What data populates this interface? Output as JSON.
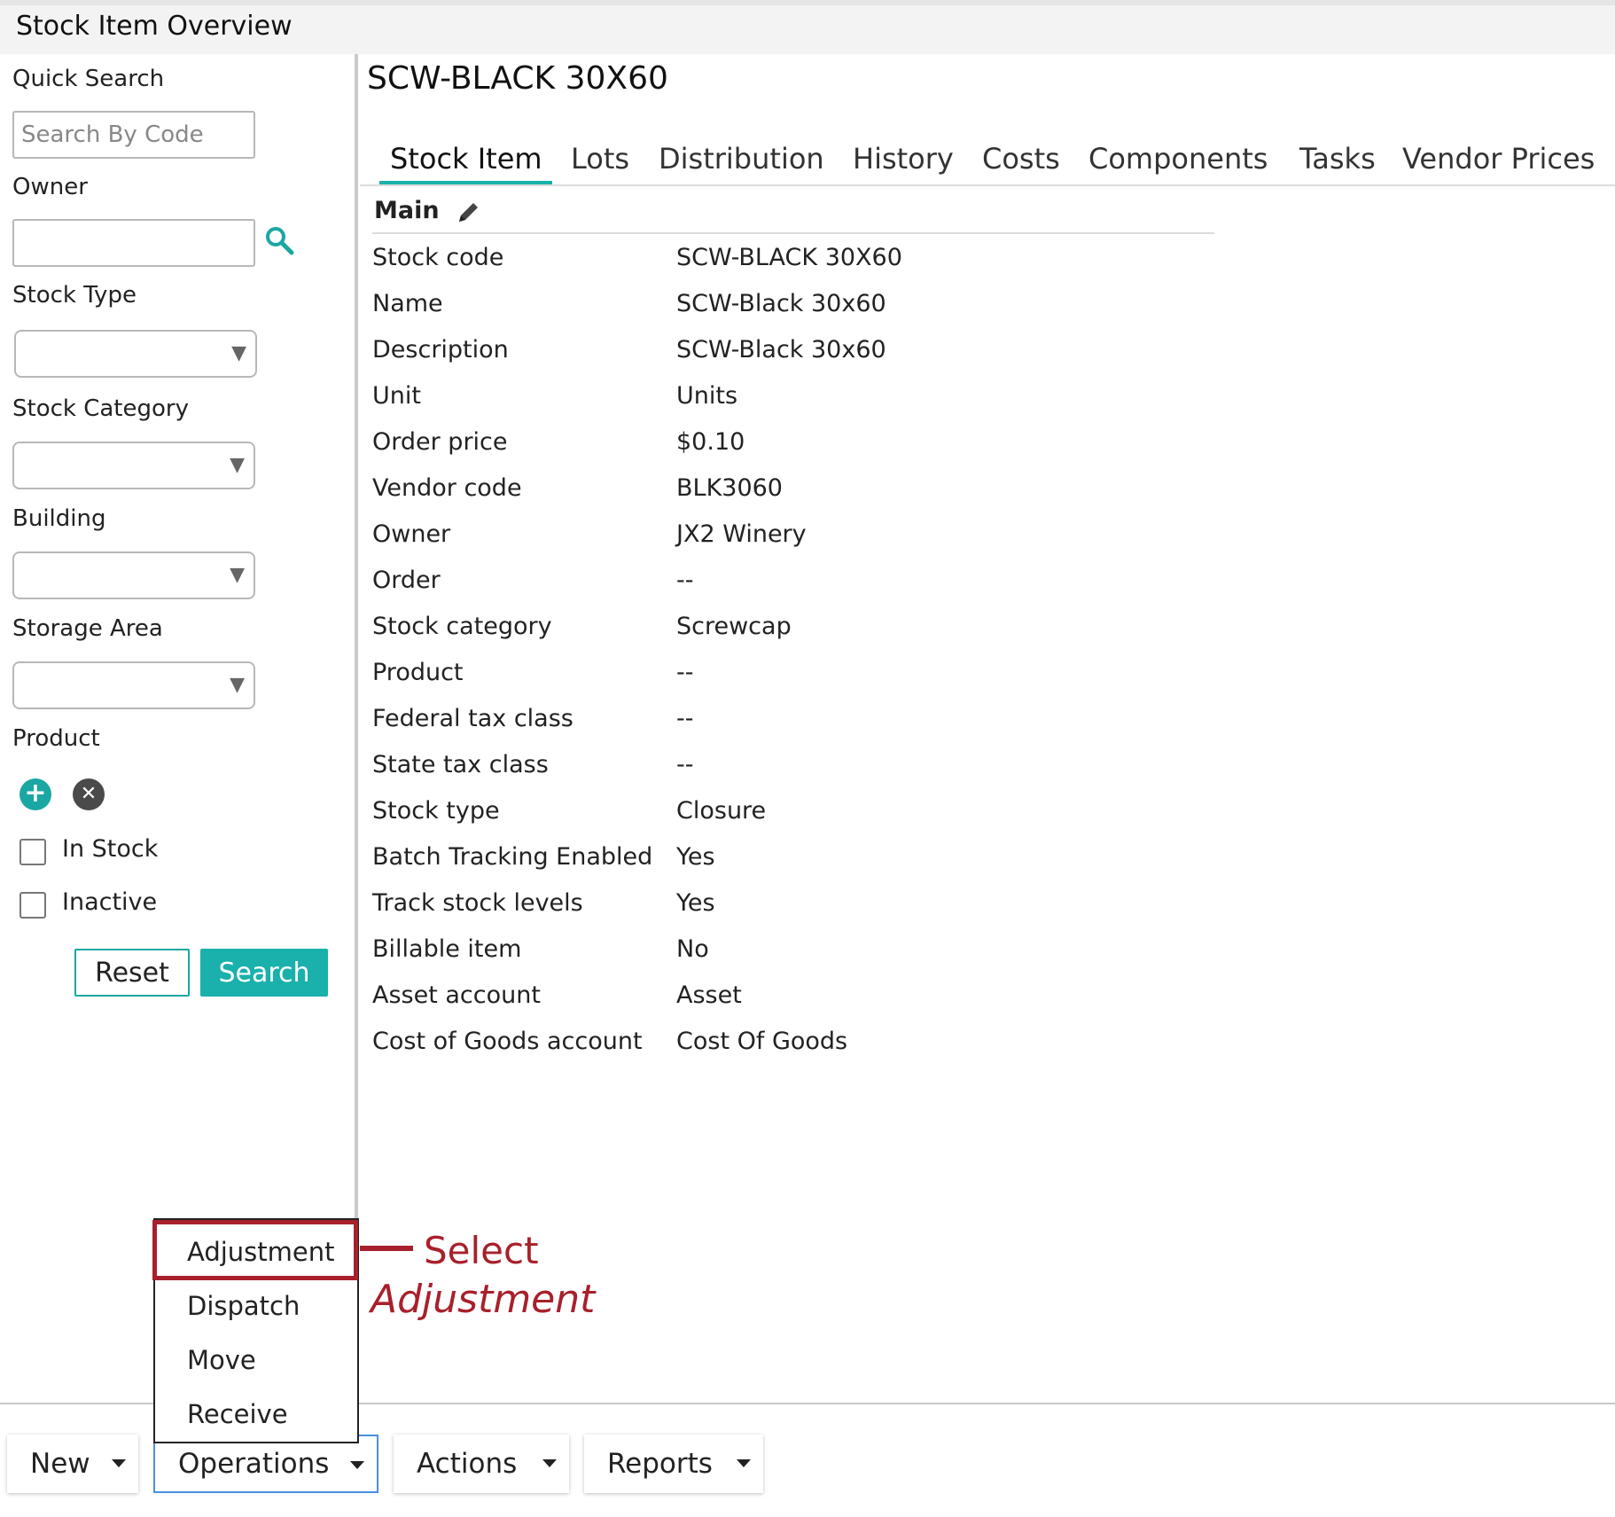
{
  "window": {
    "title": "Stock Item Overview"
  },
  "sidebar": {
    "quick_search_label": "Quick Search",
    "search_placeholder": "Search By Code",
    "owner_label": "Owner",
    "stock_type_label": "Stock Type",
    "stock_category_label": "Stock Category",
    "building_label": "Building",
    "storage_area_label": "Storage Area",
    "product_label": "Product",
    "in_stock_label": "In Stock",
    "inactive_label": "Inactive",
    "reset_label": "Reset",
    "search_label": "Search"
  },
  "item": {
    "title": "SCW-BLACK 30X60"
  },
  "tabs": [
    {
      "label": "Stock Item",
      "active": true
    },
    {
      "label": "Lots"
    },
    {
      "label": "Distribution"
    },
    {
      "label": "History"
    },
    {
      "label": "Costs"
    },
    {
      "label": "Components"
    },
    {
      "label": "Tasks"
    },
    {
      "label": "Vendor Prices"
    }
  ],
  "section": {
    "title": "Main"
  },
  "fields": [
    {
      "label": "Stock code",
      "value": "SCW-BLACK 30X60"
    },
    {
      "label": "Name",
      "value": "SCW-Black 30x60"
    },
    {
      "label": "Description",
      "value": "SCW-Black 30x60"
    },
    {
      "label": "Unit",
      "value": "Units"
    },
    {
      "label": "Order price",
      "value": "$0.10"
    },
    {
      "label": "Vendor code",
      "value": "BLK3060"
    },
    {
      "label": "Owner",
      "value": "JX2 Winery"
    },
    {
      "label": "Order",
      "value": "--"
    },
    {
      "label": "Stock category",
      "value": "Screwcap"
    },
    {
      "label": "Product",
      "value": "--"
    },
    {
      "label": "Federal tax class",
      "value": "--"
    },
    {
      "label": "State tax class",
      "value": "--"
    },
    {
      "label": "Stock type",
      "value": "Closure"
    },
    {
      "label": "Batch Tracking Enabled",
      "value": "Yes"
    },
    {
      "label": "Track stock levels",
      "value": "Yes"
    },
    {
      "label": "Billable item",
      "value": "No"
    },
    {
      "label": "Asset account",
      "value": "Asset"
    },
    {
      "label": "Cost of Goods account",
      "value": "Cost Of Goods"
    }
  ],
  "toolbar": {
    "new_label": "New",
    "operations_label": "Operations",
    "actions_label": "Actions",
    "reports_label": "Reports"
  },
  "operations_menu": [
    "Adjustment",
    "Dispatch",
    "Move",
    "Receive"
  ],
  "annotation": {
    "line1": "Select",
    "line2": "Adjustment",
    "color": "#a8202b"
  },
  "colors": {
    "accent": "#1ab0ab",
    "highlight": "#a8202b",
    "menu_open_border": "#4a90d9"
  },
  "icons": [
    "search-icon",
    "pencil-icon",
    "plus-icon",
    "close-icon",
    "chevron-down-icon",
    "caret-down-icon"
  ]
}
